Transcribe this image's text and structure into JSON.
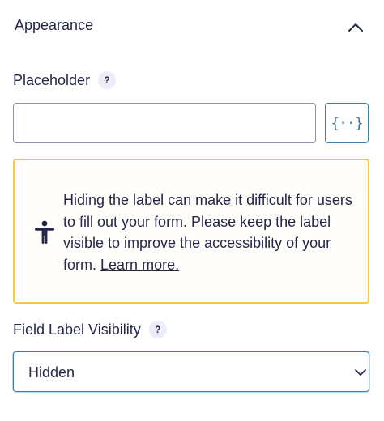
{
  "appearance": {
    "title": "Appearance"
  },
  "placeholder": {
    "label": "Placeholder",
    "help": "?",
    "value": "",
    "merge_tag_glyph": "{··}"
  },
  "notice": {
    "text": "Hiding the label can make it difficult for users to fill out your form. Please keep the label visible to improve the accessibility of your form.",
    "link": "Learn more.",
    "icon": "accessibility-icon",
    "border_color": "#f8c74a"
  },
  "label_visibility": {
    "label": "Field Label Visibility",
    "help": "?",
    "selected": "Hidden"
  },
  "colors": {
    "text": "#242748",
    "accent": "#3e7da6",
    "warning": "#f8c74a"
  }
}
